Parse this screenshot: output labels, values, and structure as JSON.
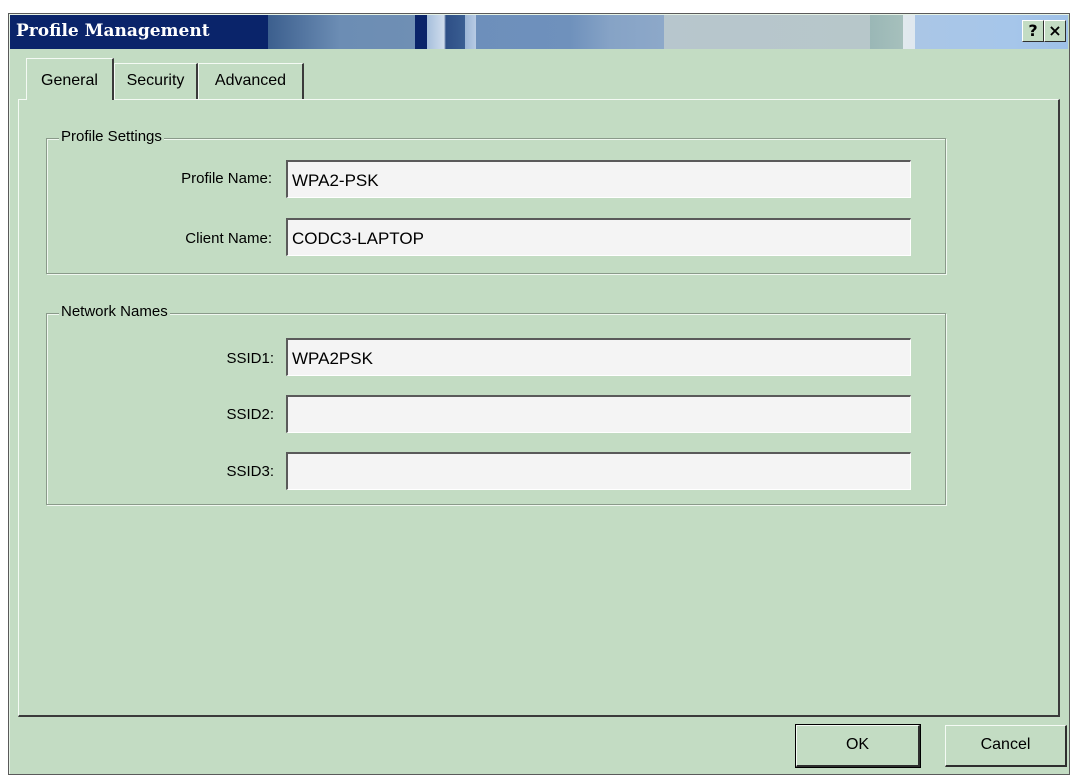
{
  "window": {
    "title": "Profile Management",
    "help_button": "?",
    "close_button": "×"
  },
  "tabs": [
    {
      "label": "General",
      "selected": true
    },
    {
      "label": "Security",
      "selected": false
    },
    {
      "label": "Advanced",
      "selected": false
    }
  ],
  "profile_settings": {
    "legend": "Profile Settings",
    "profile_name_label": "Profile Name:",
    "profile_name_value": "WPA2-PSK",
    "client_name_label": "Client Name:",
    "client_name_value": "CODC3-LAPTOP"
  },
  "network_names": {
    "legend": "Network Names",
    "ssid1_label": "SSID1:",
    "ssid1_value": "WPA2PSK",
    "ssid2_label": "SSID2:",
    "ssid2_value": "",
    "ssid3_label": "SSID3:",
    "ssid3_value": ""
  },
  "buttons": {
    "ok": "OK",
    "cancel": "Cancel"
  },
  "colors": {
    "dialog_bg": "#c3dcc3",
    "titlebar_active": "#0a246a",
    "field_bg": "#f4f4f4"
  }
}
